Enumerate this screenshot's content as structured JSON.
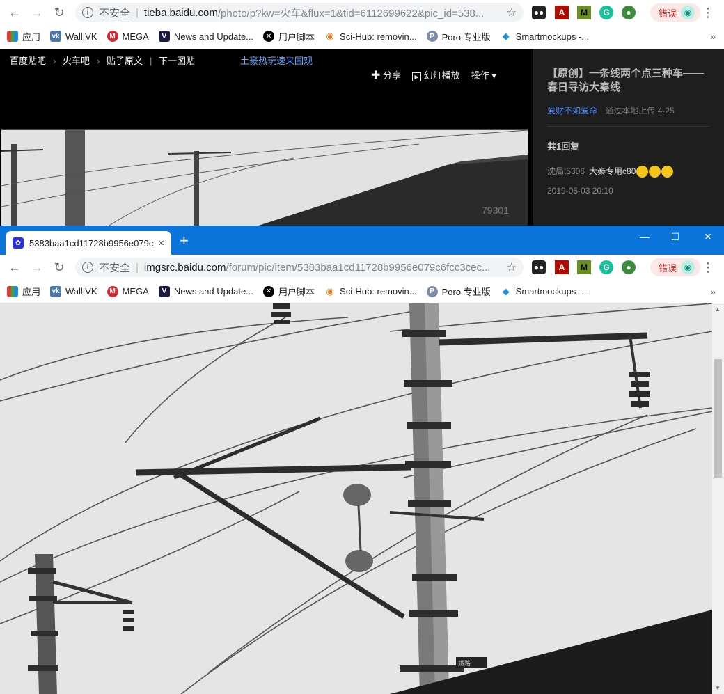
{
  "back_window": {
    "omnibox": {
      "info_glyph": "i",
      "security": "不安全",
      "host": "tieba.baidu.com",
      "path": "/photo/p?kw=火车&flux=1&tid=6112699622&pic_id=538..."
    },
    "bookmarks": [
      {
        "label": "应用",
        "icon": "apps-grid-icon"
      },
      {
        "label": "Wall|VK",
        "icon": "vk-icon"
      },
      {
        "label": "MEGA",
        "icon": "mega-icon"
      },
      {
        "label": "News and Update...",
        "icon": "v-icon"
      },
      {
        "label": "用户脚本",
        "icon": "userscript-icon"
      },
      {
        "label": "Sci-Hub: removin...",
        "icon": "scihub-icon"
      },
      {
        "label": "Poro 专业版",
        "icon": "poro-icon"
      },
      {
        "label": "Smartmockups -...",
        "icon": "smartmockups-icon"
      }
    ],
    "bookmarks_more": "»",
    "error_label": "错误",
    "tieba": {
      "breadcrumb": [
        "百度贴吧",
        "火车吧",
        "贴子原文",
        "下一图贴"
      ],
      "promo": "土豪热玩速来围观",
      "actions": {
        "share": "分享",
        "slideshow": "幻灯播放",
        "operate": "操作"
      },
      "post_title": "【原创】一条线两个点三种车——春日寻访大秦线",
      "author": "爱财不如爱命",
      "upload_info": "通过本地上传",
      "upload_date": "4-25",
      "reply_count": "共1回复",
      "reply_user": "沈局t5306",
      "reply_text": "大秦专用c80",
      "reply_date": "2019-05-03 20:10"
    }
  },
  "front_window": {
    "tab_title": "5383baa1cd11728b9956e079c",
    "tab_close": "×",
    "new_tab": "+",
    "window_controls": {
      "minimize": "—",
      "maximize": "☐",
      "close": "✕"
    },
    "omnibox": {
      "info_glyph": "i",
      "security": "不安全",
      "host": "imgsrc.baidu.com",
      "path": "/forum/pic/item/5383baa1cd11728b9956e079c6fcc3cec..."
    },
    "bookmarks": [
      {
        "label": "应用",
        "icon": "apps-grid-icon"
      },
      {
        "label": "Wall|VK",
        "icon": "vk-icon"
      },
      {
        "label": "MEGA",
        "icon": "mega-icon"
      },
      {
        "label": "News and Update...",
        "icon": "v-icon"
      },
      {
        "label": "用户脚本",
        "icon": "userscript-icon"
      },
      {
        "label": "Sci-Hub: removin...",
        "icon": "scihub-icon"
      },
      {
        "label": "Poro 专业版",
        "icon": "poro-icon"
      },
      {
        "label": "Smartmockups -...",
        "icon": "smartmockups-icon"
      }
    ],
    "bookmarks_more": "»",
    "error_label": "错误",
    "image_note_glyph": "鐵路"
  },
  "colors": {
    "titlebar": "#0a74da",
    "tieba_link": "#4e86ff",
    "error_bg": "#fce8e6"
  }
}
